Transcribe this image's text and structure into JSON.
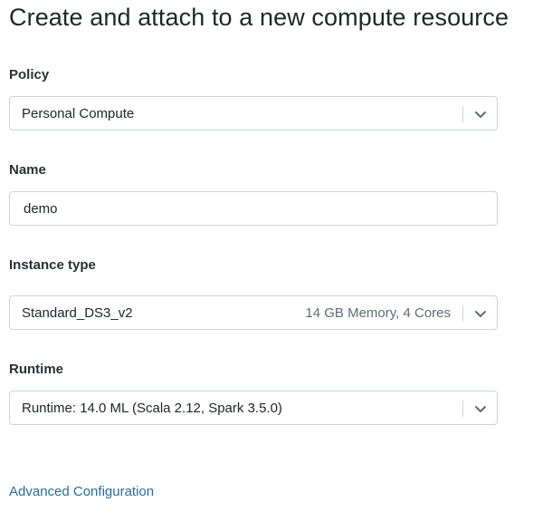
{
  "title": "Create and attach to a new compute resource",
  "policy": {
    "label": "Policy",
    "value": "Personal Compute"
  },
  "name": {
    "label": "Name",
    "value": "demo"
  },
  "instance_type": {
    "label": "Instance type",
    "value": "Standard_DS3_v2",
    "detail": "14 GB Memory, 4 Cores"
  },
  "runtime": {
    "label": "Runtime",
    "value": "Runtime: 14.0 ML (Scala 2.12, Spark 3.5.0)"
  },
  "advanced_link": "Advanced Configuration",
  "icons": {
    "dropdown": "chevron-down-icon"
  },
  "colors": {
    "link": "#2a6d96",
    "border": "#cfd4d9",
    "hint": "#5f6b78"
  }
}
